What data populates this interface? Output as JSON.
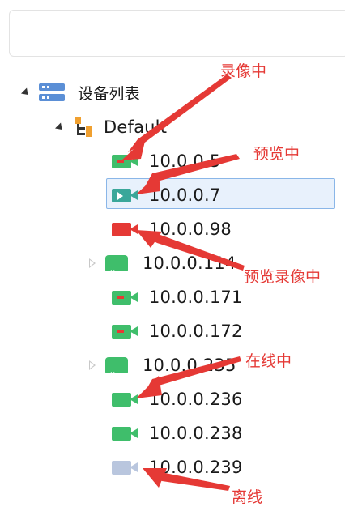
{
  "search": {
    "placeholder": ""
  },
  "tree": {
    "root_label": "设备列表",
    "group_label": "Default",
    "devices": [
      {
        "ip": "10.0.0.5",
        "state": "recording"
      },
      {
        "ip": "10.0.0.7",
        "state": "previewing",
        "selected": true
      },
      {
        "ip": "10.0.0.98",
        "state": "preview-recording"
      },
      {
        "ip": "10.0.0.114",
        "state": "nvr",
        "expandable": true
      },
      {
        "ip": "10.0.0.171",
        "state": "recording"
      },
      {
        "ip": "10.0.0.172",
        "state": "recording"
      },
      {
        "ip": "10.0.0.235",
        "state": "nvr",
        "expandable": true
      },
      {
        "ip": "10.0.0.236",
        "state": "online"
      },
      {
        "ip": "10.0.0.238",
        "state": "online"
      },
      {
        "ip": "10.0.0.239",
        "state": "offline"
      }
    ]
  },
  "annotations": {
    "recording": "录像中",
    "previewing": "预览中",
    "preview_recording": "预览录像中",
    "online": "在线中",
    "offline": "离线"
  },
  "colors": {
    "green": "#3fbe6b",
    "teal": "#3aa79a",
    "red": "#e53935",
    "offline": "#b9c6de",
    "annotation": "#e53935",
    "selection_border": "#8ab6e8",
    "selection_fill": "#e8f1fc"
  }
}
